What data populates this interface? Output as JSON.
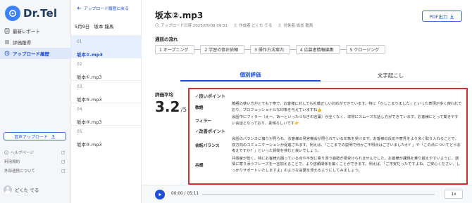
{
  "brand": {
    "name": "Dr.Tel"
  },
  "sidebar": {
    "nav": [
      {
        "label": "最新レポート",
        "icon": "report-icon"
      },
      {
        "label": "評価獲得",
        "icon": "list-icon"
      },
      {
        "label": "アップロード履歴",
        "icon": "history-icon",
        "active": true
      }
    ],
    "upload_label": "音声アップロード",
    "links": [
      {
        "label": "ヘルプページ"
      },
      {
        "label": "利用規約"
      },
      {
        "label": "外部連携について"
      }
    ],
    "user_name": "どくた てる"
  },
  "list": {
    "back_label": "アップロード履歴に戻る",
    "date": "5月9日",
    "person": "坂本 龍馬",
    "items": [
      {
        "num": "01",
        "name": "坂本②.mp3",
        "active": true
      },
      {
        "num": "02",
        "name": "坂本①.mp3"
      },
      {
        "num": "03",
        "name": "坂本⑤.mp3"
      },
      {
        "num": "04",
        "name": "坂本③.mp3"
      },
      {
        "num": "05",
        "name": "坂本④.mp3"
      }
    ]
  },
  "main": {
    "title": "坂本②.mp3",
    "meta": {
      "upload_date": "アップロード日時  2025/05/09 09:51",
      "author": "作成者  どくた てる",
      "target": "対象者  坂本 龍馬"
    },
    "pdf_label": "PDF出力",
    "flow_title": "通話の流れ",
    "flow_steps": [
      "1 オープニング",
      "2 学習の修正依頼",
      "3 操作方法案内",
      "4 応募者情報編集",
      "5 クロージング"
    ],
    "tabs": [
      "個別評価",
      "文字起こし"
    ],
    "avg_label": "評価平均",
    "avg_value": "3.2",
    "avg_max": "/5",
    "good_title": "✓良いポイント",
    "good": [
      {
        "label": "敬語",
        "text": "敬語の使い方がとても丁寧で、お客様に対しても礼儀正しい対応ができています。特に「かしこまりました」といった表現が多く使われており、プロフェッショナルな印象を与えていますね👍"
      },
      {
        "label": "フィラー",
        "text": "会話中にフィラー（えー、あーといったつなぎの言葉）が全くなく、非常にスムーズな話し方ができています。お客様にとって聞きやすい会話となっており、素晴らしいです👉"
      }
    ],
    "improve_title": "✓改善ポイント",
    "improve": [
      {
        "label": "会話バランス",
        "text": "会話のバランスに偏りが見られ、お客様の発言機会が限られている印象を受けます。お客様の反応や意見をより多く取り入れることで、双方向のコミュニケーションが促進されます。例えば、「ここまでの説明で何かご不明点はございましたか？」や「この点についてどうお考えですか？」といった質問を挟むと良いでしょう。"
      },
      {
        "label": "共感",
        "text": "共感度が低く、特にお客様の困っている点や不安に寄り添う姿勢が見受けられませんでした。お客様が課題を乗り越えやすいように、感情に寄り添うフレーズを一言加えることで、より信頼関係を築くことができます。例えば、「ご不安だったですよね、ご安心ください、しっかりサポートいたしますよ」のような言葉を添えるようにしてみましょう。"
      }
    ]
  },
  "player": {
    "time": "00:00 / 05:11",
    "speed": "1x"
  }
}
